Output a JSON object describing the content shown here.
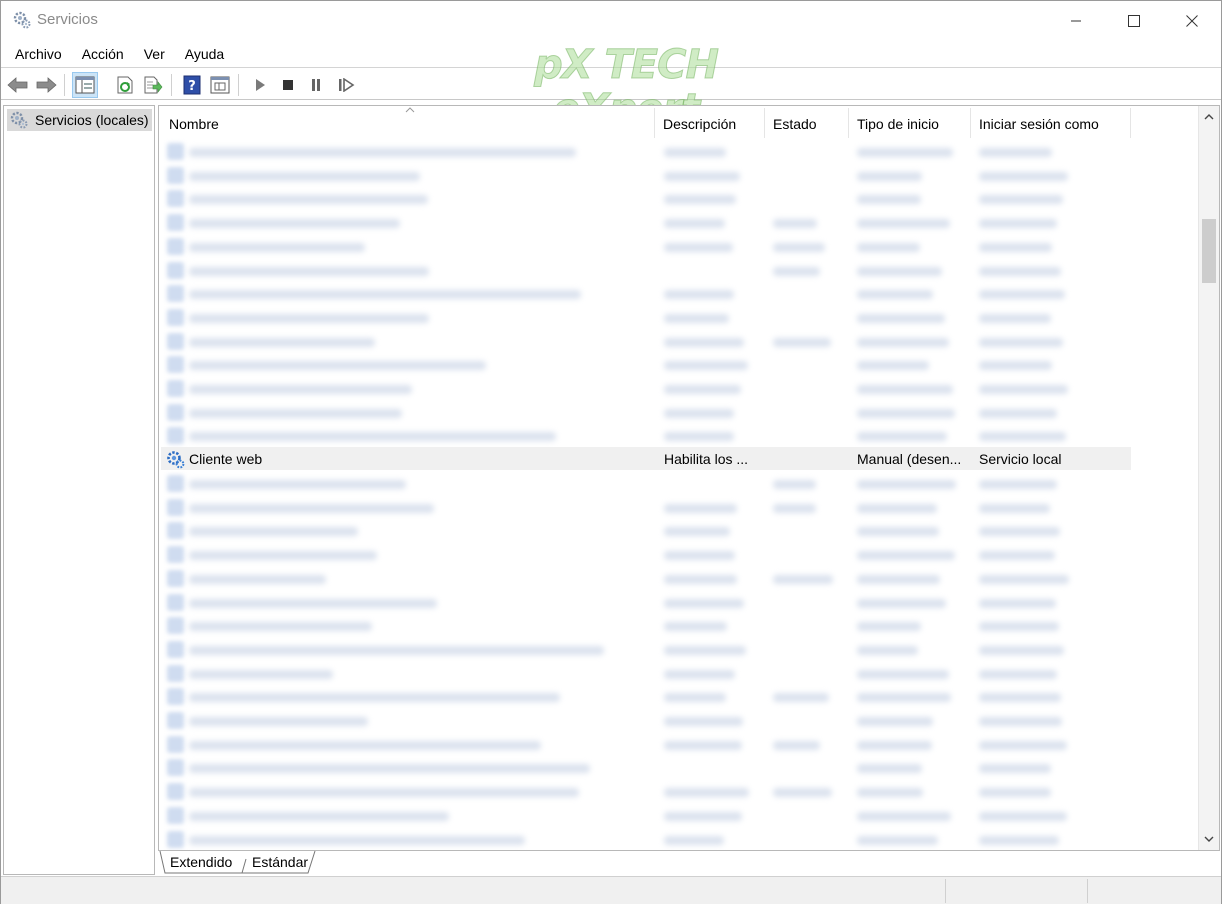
{
  "window": {
    "title": "Servicios"
  },
  "menu": {
    "items": [
      "Archivo",
      "Acción",
      "Ver",
      "Ayuda"
    ]
  },
  "toolbar": {
    "icons": [
      "back-arrow-icon",
      "forward-arrow-icon",
      "show-hide-tree-icon",
      "refresh-icon",
      "export-list-icon",
      "help-icon",
      "properties-icon",
      "play-icon",
      "stop-icon",
      "pause-icon",
      "restart-icon"
    ]
  },
  "watermark": {
    "line1": "pX TECH",
    "line2": "eXpert"
  },
  "tree": {
    "root_label": "Servicios (locales)"
  },
  "columns": {
    "name": "Nombre",
    "description": "Descripción",
    "status": "Estado",
    "startup": "Tipo de inicio",
    "logon": "Iniciar sesión como"
  },
  "highlighted_service": {
    "name": "Cliente web",
    "description": "Habilita los ...",
    "status": "",
    "startup": "Manual (desen...",
    "logon": "Servicio local"
  },
  "tabs": {
    "extended": "Extendido",
    "standard": "Estándar"
  },
  "colors": {
    "selection": "#f0f0f0",
    "accent": "#0078d7",
    "blurred_text": "#b9c3d6"
  }
}
